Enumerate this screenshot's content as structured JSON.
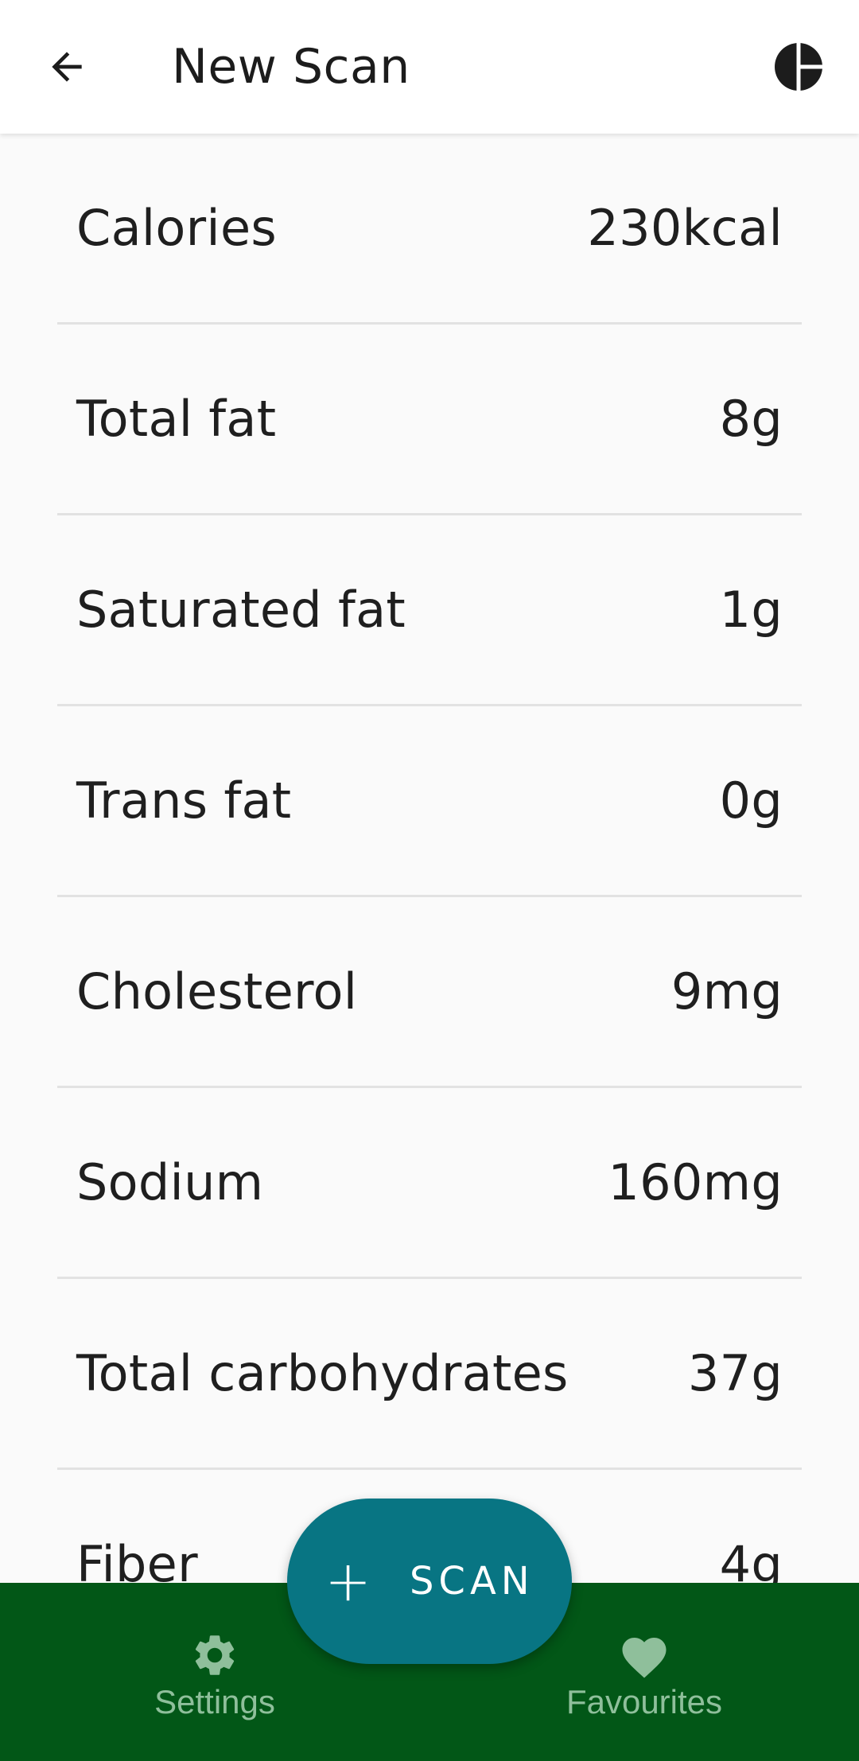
{
  "header": {
    "title": "New Scan"
  },
  "nutrients": [
    {
      "label": "Calories",
      "value": "230kcal"
    },
    {
      "label": "Total fat",
      "value": "8g"
    },
    {
      "label": "Saturated fat",
      "value": "1g"
    },
    {
      "label": "Trans fat",
      "value": "0g"
    },
    {
      "label": "Cholesterol",
      "value": "9mg"
    },
    {
      "label": "Sodium",
      "value": "160mg"
    },
    {
      "label": "Total carbohydrates",
      "value": "37g"
    },
    {
      "label": "Fiber",
      "value": "4g"
    }
  ],
  "fab": {
    "plus": "+",
    "label": "SCAN"
  },
  "bottom_nav": {
    "settings_label": "Settings",
    "favourites_label": "Favourites"
  },
  "icons": {
    "back": "arrow-left-icon",
    "theme": "contrast-icon",
    "settings": "gear-icon",
    "favourites": "heart-icon"
  },
  "colors": {
    "fab_bg": "#087583",
    "bottom_nav_bg": "#025717",
    "nav_inactive": "#8fbf9b"
  }
}
